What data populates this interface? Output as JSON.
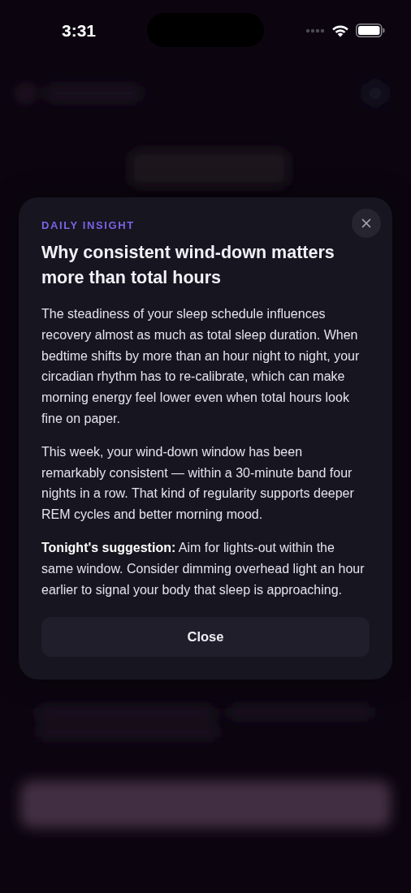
{
  "status_bar": {
    "time": "3:31"
  },
  "insight": {
    "eyebrow": "DAILY INSIGHT",
    "title": "Why consistent wind-down matters more than total hours",
    "paragraphs": [
      "The steadiness of your sleep schedule influences recovery almost as much as total sleep duration. When bedtime shifts by more than an hour night to night, your circadian rhythm has to re-calibrate, which can make morning energy feel lower even when total hours look fine on paper.",
      "This week, your wind-down window has been remarkably consistent — within a 30-minute band four nights in a row. That kind of regularity supports deeper REM cycles and better morning mood.",
      "**Tonight's suggestion:** Aim for lights-out within the same window. Consider dimming overhead light an hour earlier to signal your body that sleep is approaching."
    ],
    "close_button": "Close"
  }
}
